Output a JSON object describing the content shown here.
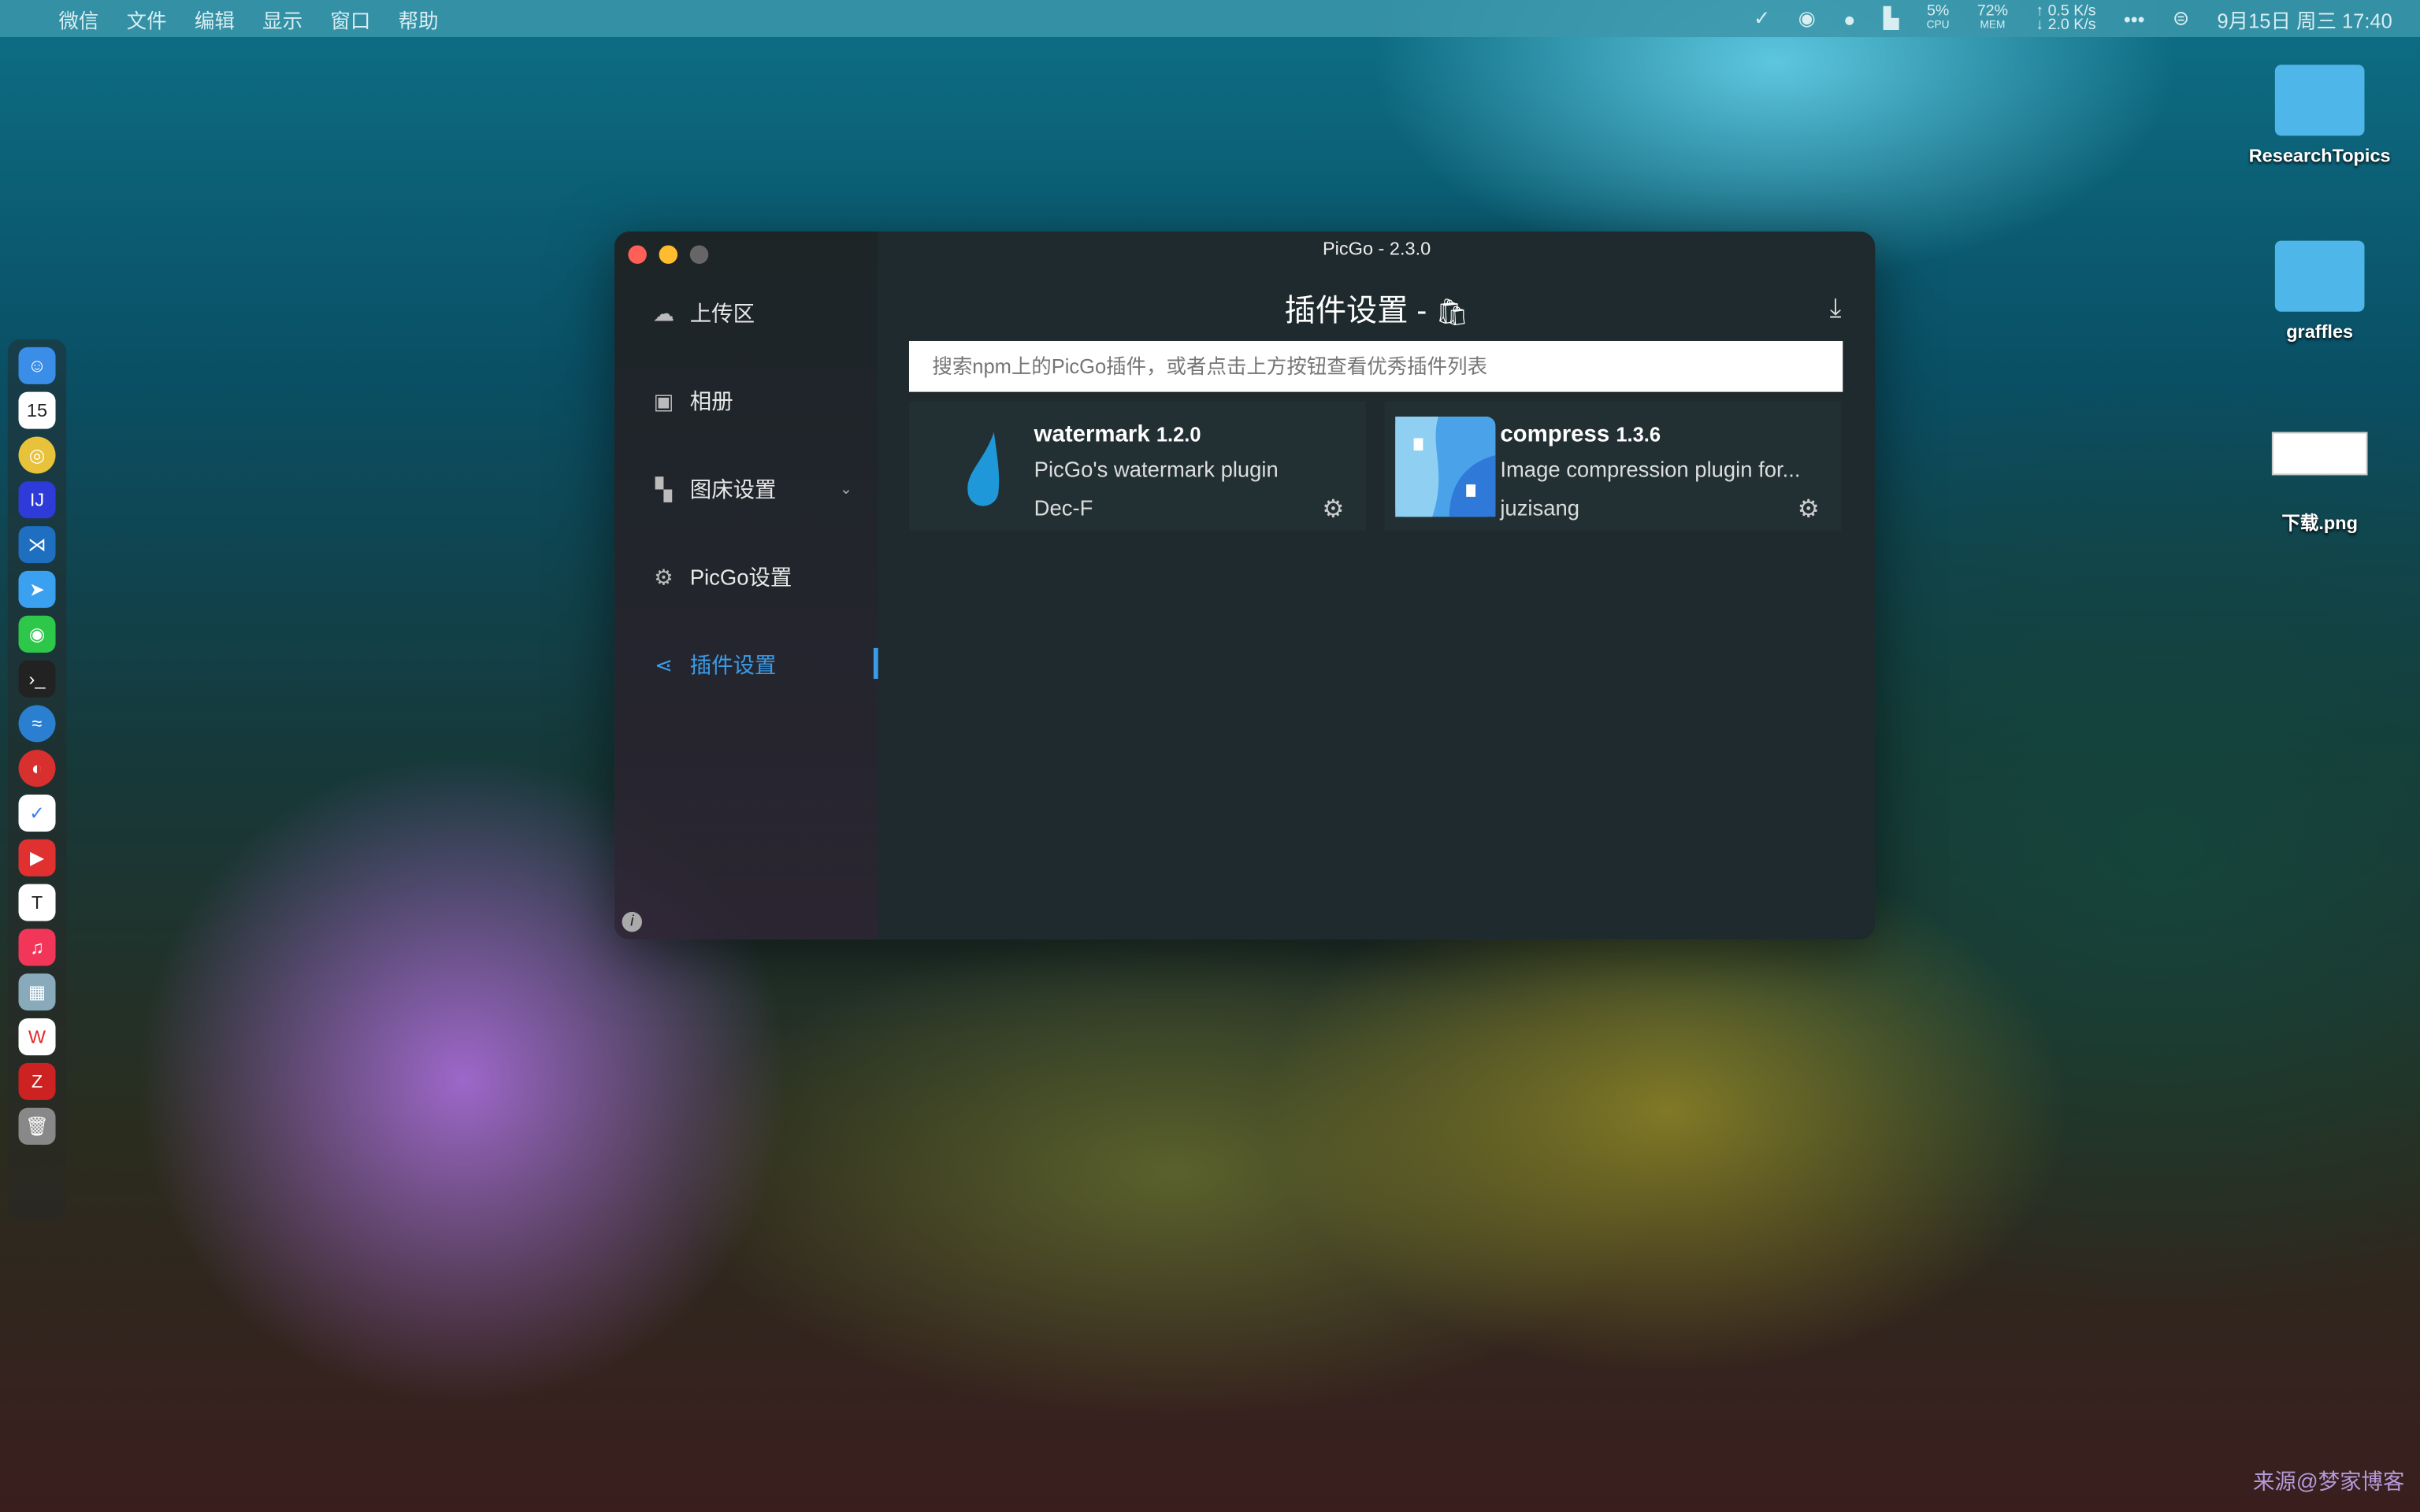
{
  "menubar": {
    "apple": "",
    "items": [
      "微信",
      "文件",
      "编辑",
      "显示",
      "窗口",
      "帮助"
    ],
    "cpu": "5%",
    "cpu_label": "CPU",
    "mem": "72%",
    "mem_label": "MEM",
    "up": "↑ 0.5 K/s",
    "down": "↓ 2.0 K/s",
    "more": "•••",
    "datetime": "9月15日 周三 17:40"
  },
  "dock": {
    "calendar_day": "15",
    "icons": [
      "finder",
      "calendar",
      "chrome",
      "intellij",
      "vscode",
      "feishu",
      "wechat",
      "terminal",
      "browser",
      "netease-music",
      "ticktick",
      "pdf",
      "typora",
      "music",
      "preview",
      "wps",
      "zotero",
      "trash"
    ]
  },
  "desktop": [
    {
      "label": "ResearchTopics"
    },
    {
      "label": "graffles"
    },
    {
      "label": "下载.png"
    }
  ],
  "window": {
    "title": "PicGo - 2.3.0",
    "sidebar": [
      {
        "label": "上传区",
        "icon": "cloud-upload-icon"
      },
      {
        "label": "相册",
        "icon": "image-icon"
      },
      {
        "label": "图床设置",
        "icon": "grid-icon"
      },
      {
        "label": "PicGo设置",
        "icon": "gear-icon"
      },
      {
        "label": "插件设置",
        "icon": "share-icon",
        "active": true
      }
    ],
    "page_title": "插件设置 -",
    "search_placeholder": "搜索npm上的PicGo插件，或者点击上方按钮查看优秀插件列表",
    "plugins": [
      {
        "name": "watermark",
        "version": "1.2.0",
        "desc": "PicGo's watermark plugin",
        "author": "Dec-F"
      },
      {
        "name": "compress",
        "version": "1.3.6",
        "desc": "Image compression plugin for...",
        "author": "juzisang"
      }
    ],
    "accent": "#3a9ce8"
  },
  "watermark": "来源@梦家博客"
}
